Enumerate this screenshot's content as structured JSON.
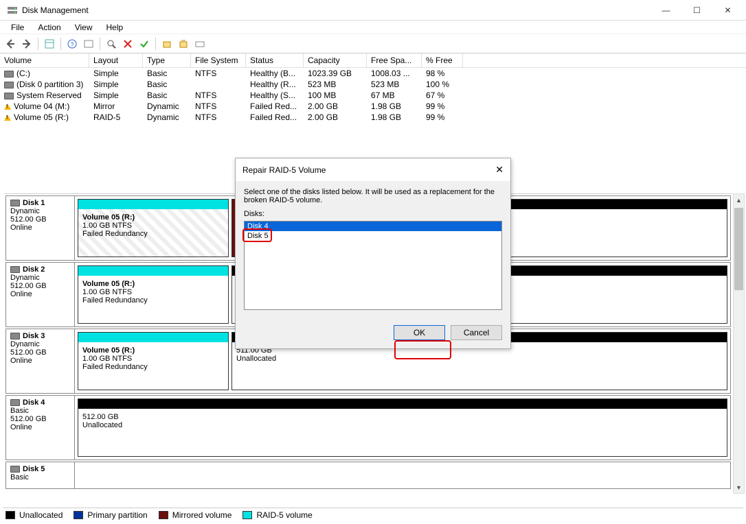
{
  "window": {
    "title": "Disk Management"
  },
  "menu": [
    "File",
    "Action",
    "View",
    "Help"
  ],
  "columns": [
    "Volume",
    "Layout",
    "Type",
    "File System",
    "Status",
    "Capacity",
    "Free Spa...",
    "% Free"
  ],
  "volumes": [
    {
      "icon": "disk",
      "name": "(C:)",
      "layout": "Simple",
      "type": "Basic",
      "fs": "NTFS",
      "status": "Healthy (B...",
      "capacity": "1023.39 GB",
      "free": "1008.03 ...",
      "pct": "98 %"
    },
    {
      "icon": "disk",
      "name": "(Disk 0 partition 3)",
      "layout": "Simple",
      "type": "Basic",
      "fs": "",
      "status": "Healthy (R...",
      "capacity": "523 MB",
      "free": "523 MB",
      "pct": "100 %"
    },
    {
      "icon": "disk",
      "name": "System Reserved",
      "layout": "Simple",
      "type": "Basic",
      "fs": "NTFS",
      "status": "Healthy (S...",
      "capacity": "100 MB",
      "free": "67 MB",
      "pct": "67 %"
    },
    {
      "icon": "warn",
      "name": "Volume 04 (M:)",
      "layout": "Mirror",
      "type": "Dynamic",
      "fs": "NTFS",
      "status": "Failed Red...",
      "capacity": "2.00 GB",
      "free": "1.98 GB",
      "pct": "99 %"
    },
    {
      "icon": "warn",
      "name": "Volume 05 (R:)",
      "layout": "RAID-5",
      "type": "Dynamic",
      "fs": "NTFS",
      "status": "Failed Red...",
      "capacity": "2.00 GB",
      "free": "1.98 GB",
      "pct": "99 %"
    }
  ],
  "disks": [
    {
      "name": "Disk 1",
      "type": "Dynamic",
      "size": "512.00 GB",
      "state": "Online",
      "parts": [
        {
          "stripe": "cyan",
          "hatched": true,
          "title": "Volume 05  (R:)",
          "line2": "1.00 GB NTFS",
          "line3": "Failed Redundancy"
        },
        {
          "narrow": true,
          "stripe": "darkred"
        },
        {
          "stripe": "black"
        }
      ]
    },
    {
      "name": "Disk 2",
      "type": "Dynamic",
      "size": "512.00 GB",
      "state": "Online",
      "parts": [
        {
          "stripe": "cyan",
          "title": "Volume 05  (R:)",
          "line2": "1.00 GB NTFS",
          "line3": "Failed Redundancy"
        },
        {
          "stripe": "black"
        }
      ]
    },
    {
      "name": "Disk 3",
      "type": "Dynamic",
      "size": "512.00 GB",
      "state": "Online",
      "parts": [
        {
          "stripe": "cyan",
          "title": "Volume 05  (R:)",
          "line2": "1.00 GB NTFS",
          "line3": "Failed Redundancy"
        },
        {
          "stripe": "black",
          "line2": "511.00 GB",
          "line3": "Unallocated"
        }
      ]
    },
    {
      "name": "Disk 4",
      "type": "Basic",
      "size": "512.00 GB",
      "state": "Online",
      "parts": [
        {
          "stripe": "black",
          "line2": "512.00 GB",
          "line3": "Unallocated"
        }
      ]
    },
    {
      "name": "Disk 5",
      "type": "Basic",
      "short": true,
      "parts": []
    }
  ],
  "legend": [
    {
      "color": "black",
      "label": "Unallocated"
    },
    {
      "color": "blue",
      "label": "Primary partition"
    },
    {
      "color": "darkred",
      "label": "Mirrored volume"
    },
    {
      "color": "cyan",
      "label": "RAID-5 volume"
    }
  ],
  "dialog": {
    "title": "Repair RAID-5 Volume",
    "instruction": "Select one of the disks listed below. It will be used as a replacement for the broken RAID-5 volume.",
    "list_label": "Disks:",
    "items": [
      {
        "label": "Disk 4",
        "selected": true
      },
      {
        "label": "Disk 5",
        "selected": false
      }
    ],
    "ok": "OK",
    "cancel": "Cancel"
  }
}
